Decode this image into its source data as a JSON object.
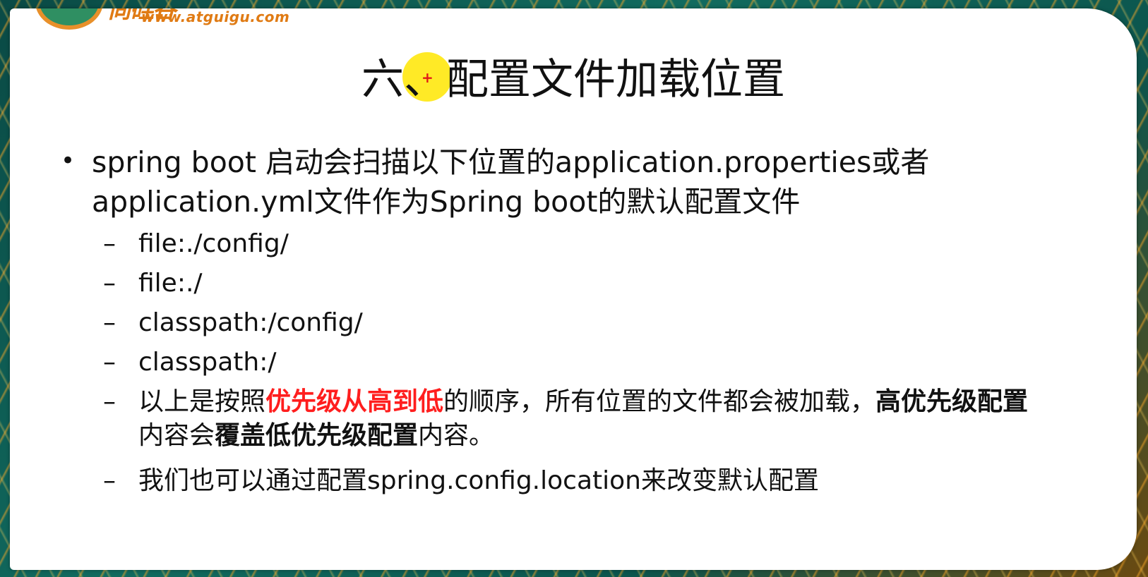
{
  "logo": {
    "brand": "尚硅谷",
    "url": "www.atguigu.com"
  },
  "title": "六、配置文件加载位置",
  "bullet": {
    "text": "spring boot 启动会扫描以下位置的application.properties或者application.yml文件作为Spring boot的默认配置文件"
  },
  "sub_items": [
    {
      "text": "file:./config/"
    },
    {
      "text": "file:./"
    },
    {
      "text": "classpath:/config/"
    },
    {
      "text": "classpath:/"
    }
  ],
  "priority_note": {
    "part1": "以上是按照",
    "part2_red": "优先级从高到低",
    "part3": "的顺序，所有位置的文件都会被加载，",
    "part4_bold": "高优先级配置",
    "part5": "内容会",
    "part6_bold": "覆盖低优先级配置",
    "part7": "内容。"
  },
  "last_item": {
    "text": "我们也可以通过配置spring.config.location来改变默认配置"
  },
  "symbols": {
    "bullet": "•",
    "dash": "–",
    "cursor": "+"
  },
  "colors": {
    "highlight_red": "#ff1e1e",
    "cursor_yellow": "#ffe600",
    "logo_orange": "#e07b14",
    "frame_teal": "#0f5a52"
  }
}
